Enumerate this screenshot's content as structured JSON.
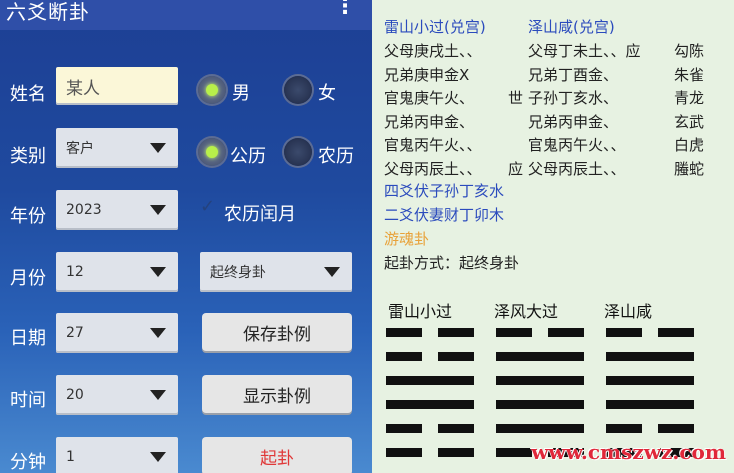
{
  "app": {
    "title": "六爻断卦"
  },
  "form": {
    "name_label": "姓名",
    "name_value": "某人",
    "gender_male": "男",
    "gender_female": "女",
    "category_label": "类别",
    "category_value": "客户",
    "calendar_solar": "公历",
    "calendar_lunar": "农历",
    "year_label": "年份",
    "year_value": "2023",
    "leap_month_label": "农历闰月",
    "month_label": "月份",
    "month_value": "12",
    "method_value": "起终身卦",
    "day_label": "日期",
    "day_value": "27",
    "save_button": "保存卦例",
    "hour_label": "时间",
    "hour_value": "20",
    "show_button": "显示卦例",
    "minute_label": "分钟",
    "minute_value": "1",
    "start_button": "起卦"
  },
  "result": {
    "gua_main": "雷山小过(兑宫)",
    "gua_changed": "泽山咸(兑宫)",
    "lines_left": [
      "父母庚戌土、、",
      "兄弟庚申金X",
      "官鬼庚午火、",
      "兄弟丙申金、",
      "官鬼丙午火、、",
      "父母丙辰土、、"
    ],
    "lines_shi_ying": [
      "",
      "",
      "世",
      "",
      "",
      "应"
    ],
    "lines_right": [
      "父母丁未土、、应",
      "兄弟丁酉金、",
      "子孙丁亥水、",
      "兄弟丙申金、",
      "官鬼丙午火、、",
      "父母丙辰土、、"
    ],
    "gods": [
      "勾陈",
      "朱雀",
      "青龙",
      "玄武",
      "白虎",
      "螣蛇"
    ],
    "fu_shen_1": "四爻伏子孙丁亥水",
    "fu_shen_2": "二爻伏妻财丁卯木",
    "you_hun": "游魂卦",
    "method_line": "起卦方式：起终身卦",
    "chart_titles": [
      "雷山小过",
      "泽风大过",
      "泽山咸"
    ],
    "hexagrams": [
      [
        0,
        0,
        1,
        1,
        0,
        0
      ],
      [
        0,
        1,
        1,
        1,
        1,
        0
      ],
      [
        0,
        1,
        1,
        1,
        0,
        0
      ]
    ]
  },
  "watermark": "www.cmszwz.com"
}
